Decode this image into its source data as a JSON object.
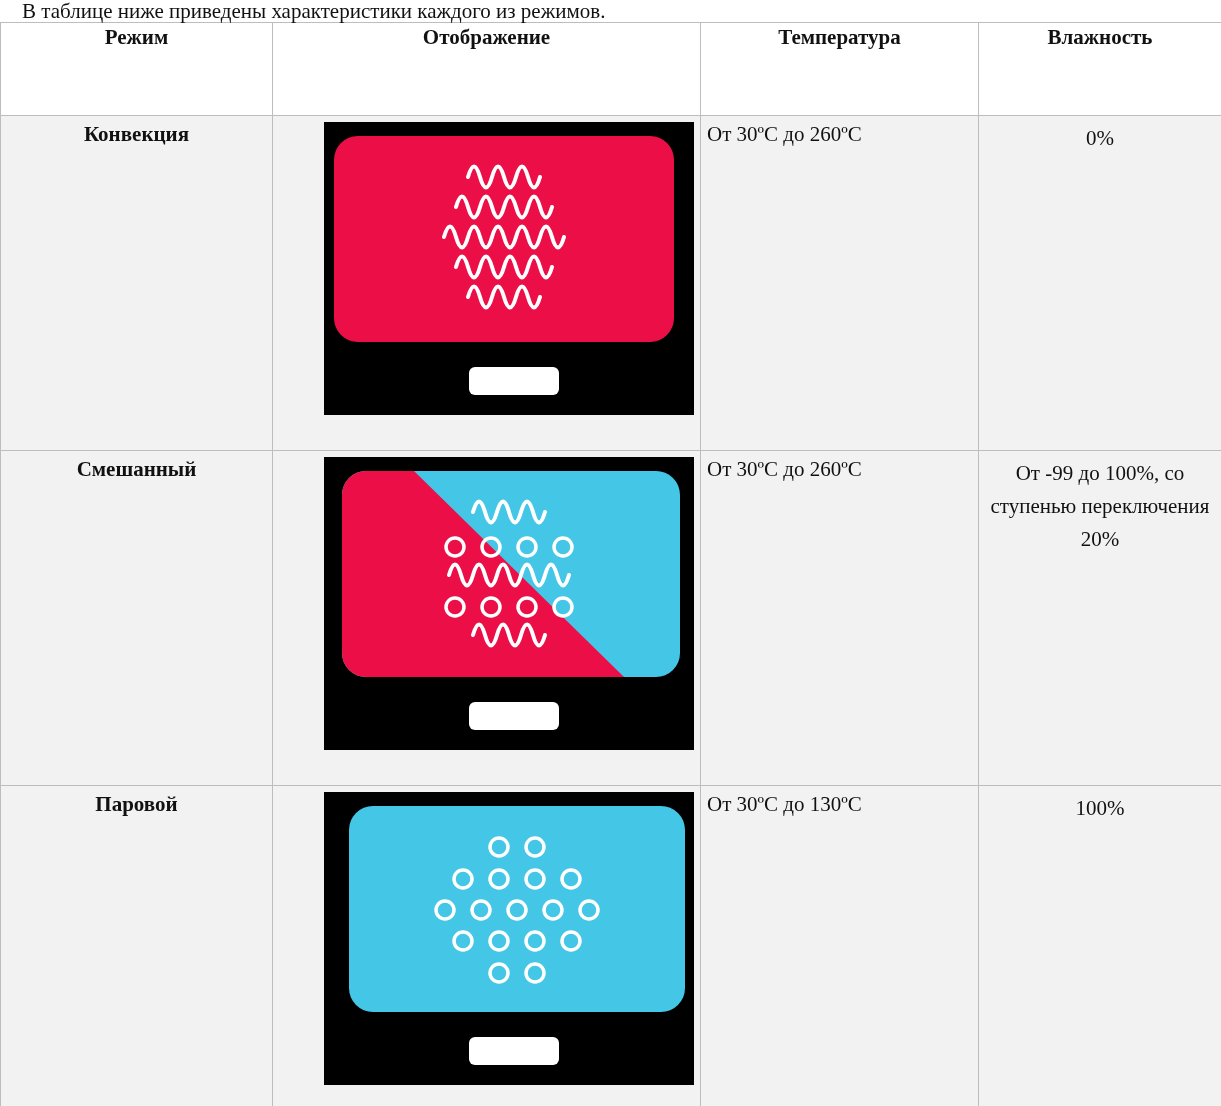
{
  "intro": "В таблице ниже приведены характеристики каждого из режимов.",
  "table": {
    "columns": [
      "Режим",
      "Отображение",
      "Температура",
      "Влажность"
    ],
    "rows": [
      {
        "mode": "Конвекция",
        "display": {
          "kind": "convection"
        },
        "temperature": "От 30ºC до 260ºC",
        "humidity": "0%"
      },
      {
        "mode": "Смешанный",
        "display": {
          "kind": "mixed"
        },
        "temperature": "От 30ºC до 260ºC",
        "humidity": "От -99 до 100%, со ступенью переключения 20%"
      },
      {
        "mode": "Паровой",
        "display": {
          "kind": "steam"
        },
        "temperature": "От 30ºC до 130ºC",
        "humidity": "100%"
      }
    ]
  }
}
